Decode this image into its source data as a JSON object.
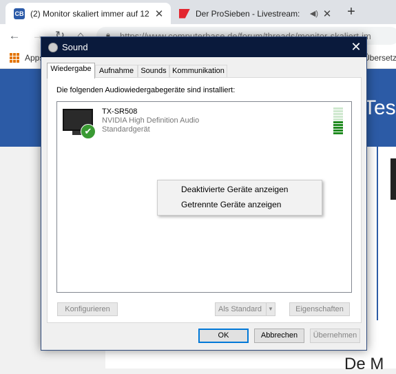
{
  "browser": {
    "tabs": [
      {
        "title": "(2) Monitor skaliert immer auf 12",
        "favicon": "computerbase-favicon",
        "active": true
      },
      {
        "title": "Der ProSieben - Livestream: ",
        "favicon": "prosieben-favicon",
        "active": false
      }
    ],
    "new_tab_label": "+",
    "url": "https://www.computerbase.de/forum/threads/monitor-skaliert-im",
    "bookmarks": {
      "apps_label": "Apps",
      "right_label": "Übersetz"
    },
    "page_banner_text": "Test",
    "page_bottom_text": "De M"
  },
  "dialog": {
    "title": "Sound",
    "close_glyph": "✕",
    "tabs": [
      "Wiedergabe",
      "Aufnahme",
      "Sounds",
      "Kommunikation"
    ],
    "selected_tab": "Wiedergabe",
    "instruction": "Die folgenden Audiowiedergabegeräte sind installiert:",
    "device": {
      "name": "TX-SR508",
      "description": "NVIDIA High Definition Audio",
      "status": "Standardgerät",
      "level_fraction": 0.5
    },
    "buttons": {
      "configure": "Konfigurieren",
      "set_default": "Als Standard",
      "properties": "Eigenschaften",
      "ok": "OK",
      "cancel": "Abbrechen",
      "apply": "Übernehmen"
    },
    "context_menu": {
      "items": [
        "Deaktivierte Geräte anzeigen",
        "Getrennte Geräte anzeigen"
      ]
    }
  },
  "colors": {
    "titlebar": "#0a1a3c",
    "default_button_border": "#0078d7",
    "banner": "#2c5ba6",
    "check": "#3a9a33"
  }
}
